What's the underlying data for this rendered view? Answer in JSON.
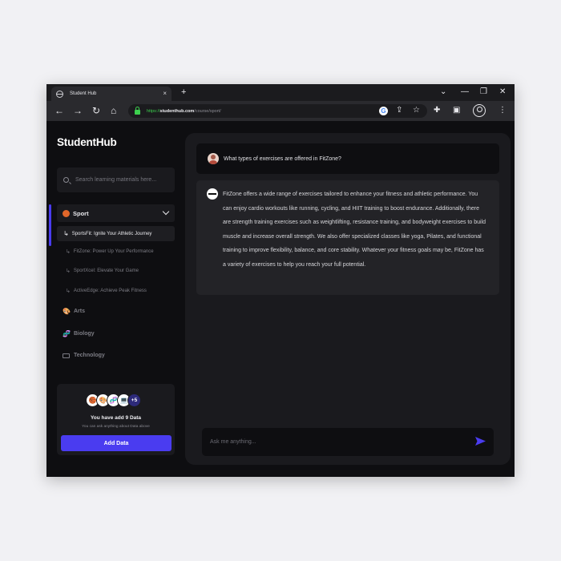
{
  "browser": {
    "tab_title": "Student Hub",
    "tab_close": "×",
    "new_tab": "+",
    "url_scheme": "https://",
    "url_domain": "studenthub.com",
    "url_path": "/course/sport/",
    "controls": {
      "dropdown": "⌄",
      "minimize": "—",
      "restore": "❐",
      "close": "✕"
    },
    "nav": {
      "back": "←",
      "forward": "→",
      "reload": "↻",
      "home": "⌂"
    },
    "toolbar_icons": {
      "google": "G",
      "share": "⇪",
      "bookmark": "☆",
      "extensions": "✚",
      "sidebar": "▣",
      "menu": "⋮"
    }
  },
  "sidebar": {
    "logo": "StudentHub",
    "search_placeholder": "Search learning materials here...",
    "active_category": {
      "icon": "🏀",
      "label": "Sport"
    },
    "subitems": [
      {
        "label": "SportsFit: Ignite Your Athletic Journey",
        "active": true
      },
      {
        "label": "FitZone: Power Up Your Performance"
      },
      {
        "label": "SportXcel: Elevate Your Game"
      },
      {
        "label": "ActiveEdge: Achieve Peak Fitness"
      }
    ],
    "categories": [
      {
        "icon": "🎨",
        "label": "Arts"
      },
      {
        "icon": "🧬",
        "label": "Biology"
      },
      {
        "icon": "💻",
        "label": "Technology"
      }
    ],
    "data_card": {
      "avatars": [
        "🏀",
        "🎨",
        "🧬",
        "💻"
      ],
      "more": "+5",
      "title": "You have add 9 Data",
      "subtitle": "You can ask anything about Data above",
      "button": "Add Data"
    }
  },
  "chat": {
    "question": "What types of exercises are offered in FitZone?",
    "answer": "FitZone offers a wide range of exercises tailored to enhance your fitness and athletic performance. You can enjoy cardio workouts like running, cycling, and HIIT training to boost endurance. Additionally, there are strength training exercises such as weightlifting, resistance training, and bodyweight exercises to build muscle and increase overall strength. We also offer specialized classes like yoga, Pilates, and functional training to improve flexibility, balance, and core stability. Whatever your fitness goals may be, FitZone has a variety of exercises to help you reach your full potential.",
    "input_placeholder": "Ask me anything...",
    "send_icon": "send-icon"
  },
  "colors": {
    "accent": "#4a3cf0",
    "background": "#0e0e11",
    "panel": "#1a1a1e",
    "lock_green": "#3ccf4e"
  }
}
